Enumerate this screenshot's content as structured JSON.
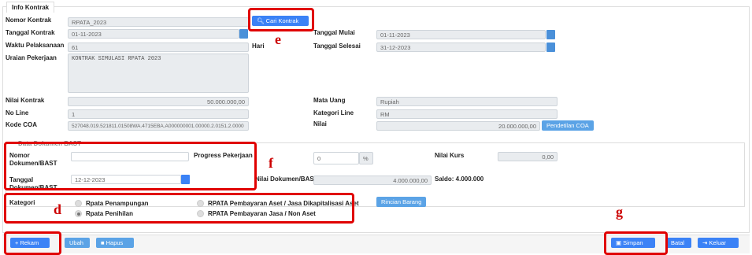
{
  "header": {
    "tab_title": "Info Kontrak"
  },
  "kontrak": {
    "nomor_label": "Nomor Kontrak",
    "nomor_value": "RPATA_2023",
    "cari_button": "Cari Kontrak",
    "tanggal_label": "Tanggal Kontrak",
    "tanggal_value": "01-11-2023",
    "waktu_label": "Waktu Pelaksanaan",
    "waktu_value": "61",
    "hari_label": "Hari",
    "tgl_mulai_label": "Tanggal Mulai",
    "tgl_mulai_value": "01-11-2023",
    "tgl_selesai_label": "Tanggal Selesai",
    "tgl_selesai_value": "31-12-2023",
    "uraian_label": "Uraian Pekerjaan",
    "uraian_value": "KONTRAK SIMULASI RPATA 2023",
    "nilai_label": "Nilai Kontrak",
    "nilai_value": "50.000.000,00",
    "mata_uang_label": "Mata Uang",
    "mata_uang_value": "Rupiah",
    "no_line_label": "No Line",
    "no_line_value": "1",
    "kategori_line_label": "Kategori Line",
    "kategori_line_value": "RM",
    "coa_label": "Kode COA",
    "coa_value": "527048.019.521811.01508WA.4715EBA.A000000001.00000.2.0151.2.0000",
    "nilai2_label": "Nilai",
    "nilai2_value": "20.000.000,00",
    "rincian_coa_button": "Pendetilan COA"
  },
  "dokumen": {
    "section_title": "Data Dokumen BAST",
    "nomor_label": "Nomor Dokumen/BAST",
    "tanggal_label": "Tanggal Dokumen/BAST",
    "tanggal_value": "12-12-2023",
    "progress_label": "Progress Pekerjaan",
    "progress_value": "0",
    "progress_unit": "%",
    "nilai_dok_label": "Nilai Dokumen/BAST",
    "nilai_dok_value": "4.000.000,00",
    "saldo_label": "Saldo: 4.000.000",
    "kurs_label": "Nilai Kurs",
    "kurs_value": "0,00"
  },
  "kategori": {
    "label": "Kategori",
    "opt1": "Rpata Penampungan",
    "opt2": "Rpata Penihilan",
    "opt3": "RPATA Pembayaran Aset / Jasa Dikapitalisasi Aset",
    "opt4": "RPATA Pembayaran Jasa / Non Aset",
    "rincian_button": "Rincian Barang"
  },
  "footer": {
    "rekam": "Rekam",
    "ubah": "Ubah",
    "hapus": "Hapus",
    "simpan": "Simpan",
    "batal": "Batal",
    "keluar": "Keluar"
  },
  "annotations": {
    "e": "e",
    "f": "f",
    "d": "d",
    "g": "g"
  },
  "colors": {
    "primary": "#3b82f6",
    "annotation": "#e00000"
  }
}
